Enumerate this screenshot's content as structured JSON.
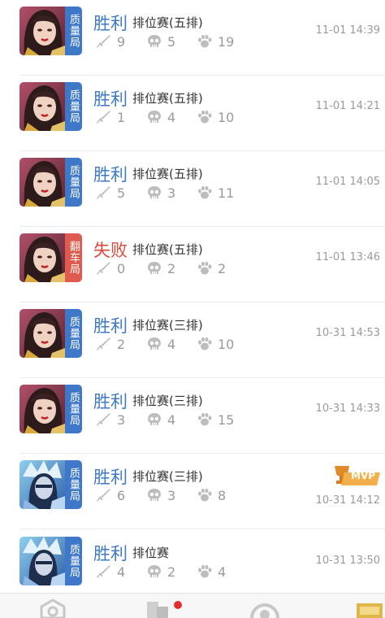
{
  "matches": [
    {
      "result": "胜利",
      "outcome": "win",
      "tag": "质量局",
      "tag_color": "#3f78c8",
      "mode": "排位赛(五排)",
      "kills": "9",
      "deaths": "5",
      "assists": "19",
      "time": "11-01 14:39",
      "hero": "female-hero-portrait",
      "mvp": false
    },
    {
      "result": "胜利",
      "outcome": "win",
      "tag": "质量局",
      "tag_color": "#3f78c8",
      "mode": "排位赛(五排)",
      "kills": "1",
      "deaths": "4",
      "assists": "10",
      "time": "11-01 14:21",
      "hero": "female-hero-portrait",
      "mvp": false
    },
    {
      "result": "胜利",
      "outcome": "win",
      "tag": "质量局",
      "tag_color": "#3f78c8",
      "mode": "排位赛(五排)",
      "kills": "5",
      "deaths": "3",
      "assists": "11",
      "time": "11-01 14:05",
      "hero": "female-hero-portrait",
      "mvp": false
    },
    {
      "result": "失败",
      "outcome": "loss",
      "tag": "翻车局",
      "tag_color": "#e05a4f",
      "mode": "排位赛(五排)",
      "kills": "0",
      "deaths": "2",
      "assists": "2",
      "time": "11-01 13:46",
      "hero": "female-hero-portrait",
      "mvp": false
    },
    {
      "result": "胜利",
      "outcome": "win",
      "tag": "质量局",
      "tag_color": "#3f78c8",
      "mode": "排位赛(三排)",
      "kills": "2",
      "deaths": "4",
      "assists": "10",
      "time": "10-31 14:53",
      "hero": "female-hero-portrait",
      "mvp": false
    },
    {
      "result": "胜利",
      "outcome": "win",
      "tag": "质量局",
      "tag_color": "#3f78c8",
      "mode": "排位赛(三排)",
      "kills": "3",
      "deaths": "4",
      "assists": "15",
      "time": "10-31 14:33",
      "hero": "female-hero-portrait",
      "mvp": false
    },
    {
      "result": "胜利",
      "outcome": "win",
      "tag": "质量局",
      "tag_color": "#3f78c8",
      "mode": "排位赛(三排)",
      "kills": "6",
      "deaths": "3",
      "assists": "8",
      "time": "10-31 14:12",
      "hero": "male-hero-portrait",
      "mvp": true,
      "mvp_label": "MVP"
    },
    {
      "result": "胜利",
      "outcome": "win",
      "tag": "质量局",
      "tag_color": "#3f78c8",
      "mode": "排位赛",
      "kills": "4",
      "deaths": "2",
      "assists": "4",
      "time": "10-31 13:50",
      "hero": "male-hero-portrait",
      "mvp": false
    }
  ],
  "stat_icons": {
    "kills": "sword-icon",
    "deaths": "skull-icon",
    "assists": "paw-icon"
  },
  "colors": {
    "win": "#3d7ac9",
    "loss": "#d9493d",
    "muted": "#9a9a9a",
    "notification_dot": "#e03131"
  },
  "tabbar": {
    "items": [
      "home-tab-icon",
      "team-tab-icon",
      "match-tab-icon",
      "rank-tab-icon"
    ],
    "notification_dot": true
  }
}
